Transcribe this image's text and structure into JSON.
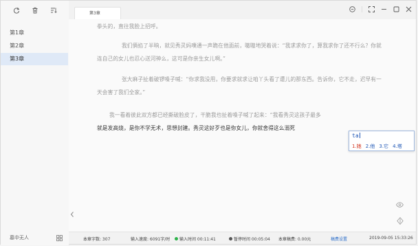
{
  "sidebar": {
    "tools": [
      "refresh-icon",
      "trash-icon",
      "sort-icon"
    ],
    "chapters": [
      {
        "label": "第1章",
        "active": false
      },
      {
        "label": "第2章",
        "active": false
      },
      {
        "label": "第3章",
        "active": true
      }
    ],
    "footer_label": "墓中无人"
  },
  "tab": {
    "title": "第3章"
  },
  "window_tools": [
    "timer-icon",
    "fullscreen-icon",
    "minimize-icon",
    "maximize-icon",
    "close-icon"
  ],
  "editor": {
    "paragraphs": [
      "拳头的，直往我脸上招呼。",
      "我们俩掐了半晌，就见秀灵妈噗通一声跪在他面前，嗷嗷地哭着说：“我求求你了，算我求你了还不行么？你就连自己的女儿也忍心送河神么，这可是你亲生女儿啊。”",
      "张大麻子扯着破锣嗓子喊：“你求我没用，你要求就求让咱丫头看了遭儿的那东西。告诉你，它不走，迟早有一天会害了我们全家。”",
      "我一看着彼此双方都已经撕破脸皮了，干脆我也扯着嗓子喊了起来：“我看秀灵这孩子最多"
    ],
    "last_line": "就是发高烧，是你不学无术，思想封建。秀灵这好歹也是你女儿，你就舍得这么溺死"
  },
  "ime": {
    "pinyin": "ta",
    "candidates": [
      "1.她",
      "2.他",
      "3.它",
      "4.塔"
    ]
  },
  "status": {
    "chapter_words": "本章字数: 307",
    "input_speed": "输入速度: 6091字/时",
    "input_time": "输入时间 00:11:41",
    "pause_time": "暂停时间 00:05:04",
    "chapter_draft": "本章稿费: 0.00元",
    "draft_settings": "稿费设置",
    "datetime": "2019-09-05  15:33:26",
    "green": "#2db24a",
    "dark": "#555555",
    "accent": "#2f6fc9"
  }
}
